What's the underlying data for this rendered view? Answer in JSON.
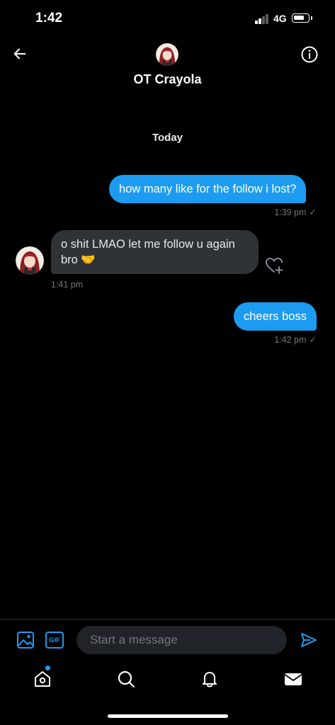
{
  "status_bar": {
    "time": "1:42",
    "network": "4G",
    "signal_bars_active": 2,
    "signal_bars_total": 4
  },
  "header": {
    "title": "OT Crayola",
    "back_icon": "arrow-left-icon",
    "info_icon": "info-icon"
  },
  "conversation": {
    "day_label": "Today",
    "messages": [
      {
        "direction": "outgoing",
        "text": "how many like for the follow i lost?",
        "time": "1:39 pm",
        "status": "✓"
      },
      {
        "direction": "incoming",
        "text": "o shit LMAO let me follow u again bro 🤝",
        "time": "1:41 pm"
      },
      {
        "direction": "outgoing",
        "text": "cheers boss",
        "time": "1:42 pm",
        "status": "✓"
      }
    ]
  },
  "composer": {
    "gif_label": "GIF",
    "placeholder": "Start a message"
  },
  "nav": {
    "items": [
      "home-icon",
      "search-icon",
      "notifications-icon",
      "messages-icon"
    ],
    "home_has_badge": true
  },
  "colors": {
    "accent": "#1d9bf0",
    "incoming_bubble": "#2f3336",
    "background": "#000000",
    "muted_text": "#71767b"
  }
}
